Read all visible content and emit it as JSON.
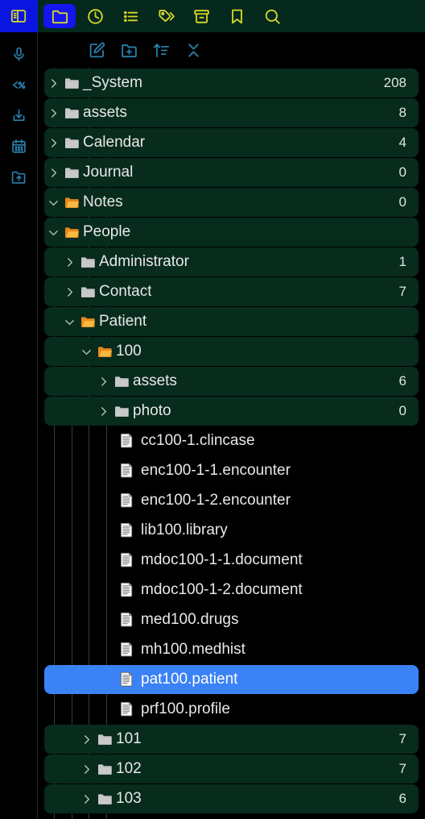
{
  "rail": {
    "items": [
      {
        "name": "sidebar-toggle-icon",
        "icon": "sidebar-toggle",
        "active": true,
        "color": "#d8d82a"
      },
      {
        "name": "microphone-icon",
        "icon": "microphone",
        "active": false,
        "color": "#2b7fae"
      },
      {
        "name": "template-icon",
        "icon": "percent-code",
        "active": false,
        "color": "#2b7fae"
      },
      {
        "name": "download-icon",
        "icon": "download",
        "active": false,
        "color": "#2b7fae"
      },
      {
        "name": "calendar-icon",
        "icon": "calendar",
        "active": false,
        "color": "#2b7fae"
      },
      {
        "name": "folder-upload-icon",
        "icon": "folder-upload",
        "active": false,
        "color": "#2b7fae"
      }
    ]
  },
  "topnav": {
    "accent_active_bg": "#1515ef",
    "icon_color": "#d8d82a",
    "items": [
      {
        "name": "tab-files",
        "icon": "folder",
        "label": "Files",
        "active": true
      },
      {
        "name": "tab-recent",
        "icon": "clock",
        "label": "Recent",
        "active": false
      },
      {
        "name": "tab-outline",
        "icon": "list",
        "label": "Outline",
        "active": false
      },
      {
        "name": "tab-tags",
        "icon": "tags",
        "label": "Tags",
        "active": false
      },
      {
        "name": "tab-archive",
        "icon": "archive",
        "label": "Archive",
        "active": false
      },
      {
        "name": "tab-bookmarks",
        "icon": "bookmark",
        "label": "Bookmarks",
        "active": false
      },
      {
        "name": "tab-search",
        "icon": "search",
        "label": "Search",
        "active": false
      }
    ]
  },
  "toolbar": {
    "icon_color": "#2b7fae",
    "items": [
      {
        "name": "new-note-button",
        "icon": "pencil-square",
        "label": "New note"
      },
      {
        "name": "new-folder-button",
        "icon": "folder-plus",
        "label": "New folder"
      },
      {
        "name": "sort-button",
        "icon": "sort-asc",
        "label": "Change sort order"
      },
      {
        "name": "collapse-all-button",
        "icon": "collapse",
        "label": "Collapse all"
      }
    ]
  },
  "theme": {
    "background": "#000000",
    "row_background": "#072b1c",
    "topnav_background": "#05291c",
    "selection": "#3b82f6",
    "text": "#e8e8e8",
    "folder_closed": "#c8c8c8",
    "folder_open": "#f0a11e",
    "guide": "#3b3b3b"
  },
  "tree": {
    "rows": [
      {
        "name": "tree-item-_System",
        "label": "_System",
        "count": "208",
        "depth": 0,
        "kind": "folder",
        "state": "collapsed"
      },
      {
        "name": "tree-item-assets",
        "label": "assets",
        "count": "8",
        "depth": 0,
        "kind": "folder",
        "state": "collapsed"
      },
      {
        "name": "tree-item-Calendar",
        "label": "Calendar",
        "count": "4",
        "depth": 0,
        "kind": "folder",
        "state": "collapsed"
      },
      {
        "name": "tree-item-Journal",
        "label": "Journal",
        "count": "0",
        "depth": 0,
        "kind": "folder",
        "state": "collapsed"
      },
      {
        "name": "tree-item-Notes",
        "label": "Notes",
        "count": "0",
        "depth": 0,
        "kind": "folder",
        "state": "expanded"
      },
      {
        "name": "tree-item-People",
        "label": "People",
        "count": "",
        "depth": 0,
        "kind": "folder",
        "state": "expanded"
      },
      {
        "name": "tree-item-Administrator",
        "label": "Administrator",
        "count": "1",
        "depth": 1,
        "kind": "folder",
        "state": "collapsed"
      },
      {
        "name": "tree-item-Contact",
        "label": "Contact",
        "count": "7",
        "depth": 1,
        "kind": "folder",
        "state": "collapsed"
      },
      {
        "name": "tree-item-Patient",
        "label": "Patient",
        "count": "",
        "depth": 1,
        "kind": "folder",
        "state": "expanded"
      },
      {
        "name": "tree-item-100",
        "label": "100",
        "count": "",
        "depth": 2,
        "kind": "folder",
        "state": "expanded"
      },
      {
        "name": "tree-item-100-assets",
        "label": "assets",
        "count": "6",
        "depth": 3,
        "kind": "folder",
        "state": "collapsed"
      },
      {
        "name": "tree-item-100-photo",
        "label": "photo",
        "count": "0",
        "depth": 3,
        "kind": "folder",
        "state": "collapsed"
      },
      {
        "name": "tree-item-cc100-1.clincase",
        "label": "cc100-1.clincase",
        "count": "",
        "depth": 4,
        "kind": "file",
        "state": ""
      },
      {
        "name": "tree-item-enc100-1-1.encounter",
        "label": "enc100-1-1.encounter",
        "count": "",
        "depth": 4,
        "kind": "file",
        "state": ""
      },
      {
        "name": "tree-item-enc100-1-2.encounter",
        "label": "enc100-1-2.encounter",
        "count": "",
        "depth": 4,
        "kind": "file",
        "state": ""
      },
      {
        "name": "tree-item-lib100.library",
        "label": "lib100.library",
        "count": "",
        "depth": 4,
        "kind": "file",
        "state": ""
      },
      {
        "name": "tree-item-mdoc100-1-1.document",
        "label": "mdoc100-1-1.document",
        "count": "",
        "depth": 4,
        "kind": "file",
        "state": ""
      },
      {
        "name": "tree-item-mdoc100-1-2.document",
        "label": "mdoc100-1-2.document",
        "count": "",
        "depth": 4,
        "kind": "file",
        "state": ""
      },
      {
        "name": "tree-item-med100.drugs",
        "label": "med100.drugs",
        "count": "",
        "depth": 4,
        "kind": "file",
        "state": ""
      },
      {
        "name": "tree-item-mh100.medhist",
        "label": "mh100.medhist",
        "count": "",
        "depth": 4,
        "kind": "file",
        "state": ""
      },
      {
        "name": "tree-item-pat100.patient",
        "label": "pat100.patient",
        "count": "",
        "depth": 4,
        "kind": "file",
        "state": "",
        "selected": true
      },
      {
        "name": "tree-item-prf100.profile",
        "label": "prf100.profile",
        "count": "",
        "depth": 4,
        "kind": "file",
        "state": ""
      },
      {
        "name": "tree-item-101",
        "label": "101",
        "count": "7",
        "depth": 2,
        "kind": "folder",
        "state": "collapsed"
      },
      {
        "name": "tree-item-102",
        "label": "102",
        "count": "7",
        "depth": 2,
        "kind": "folder",
        "state": "collapsed"
      },
      {
        "name": "tree-item-103",
        "label": "103",
        "count": "6",
        "depth": 2,
        "kind": "folder",
        "state": "collapsed"
      }
    ]
  }
}
